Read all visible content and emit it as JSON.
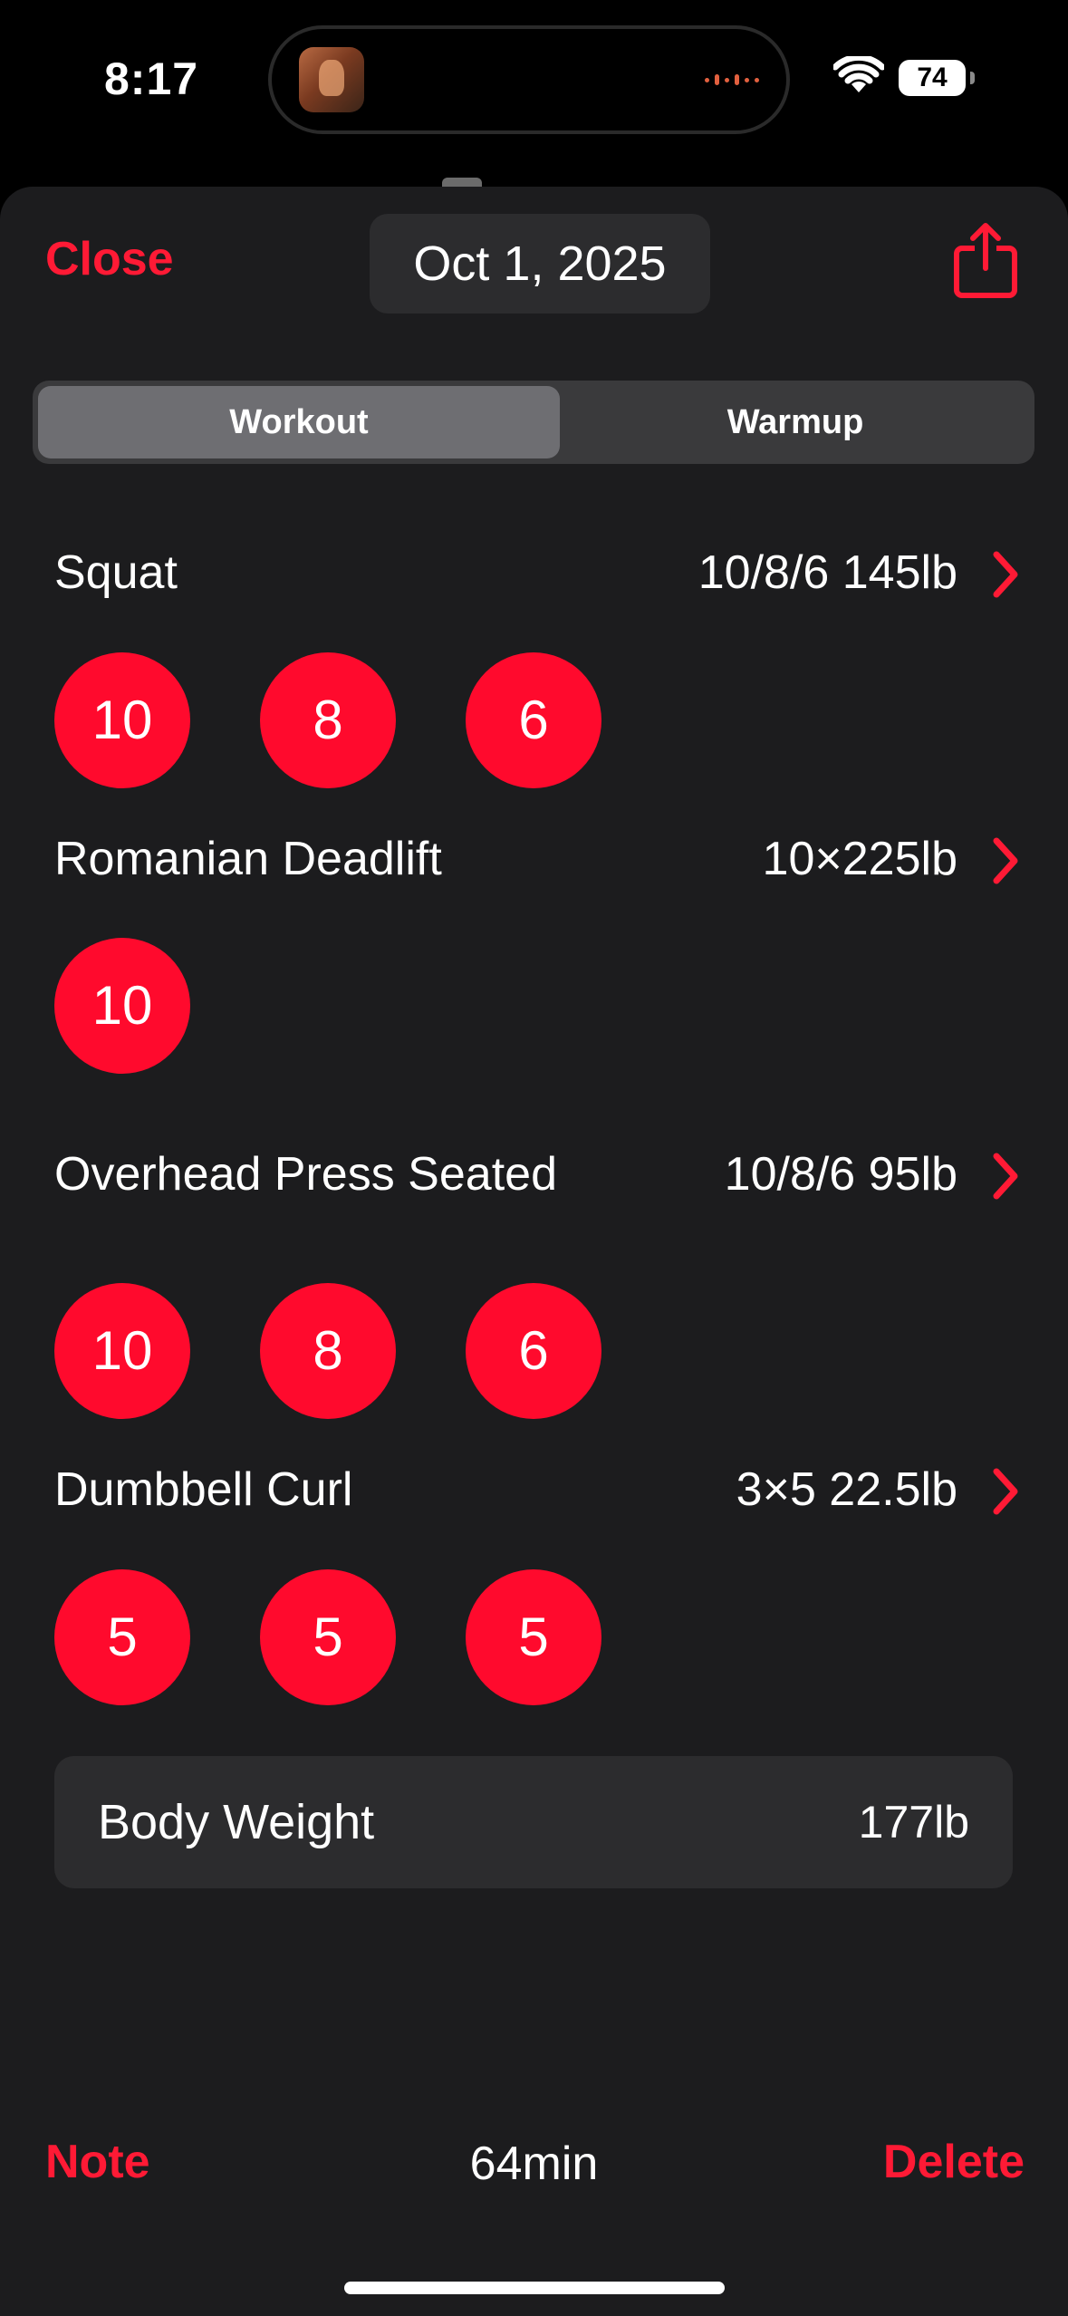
{
  "status": {
    "time": "8:17",
    "battery": "74"
  },
  "header": {
    "close_label": "Close",
    "date": "Oct 1, 2025",
    "share_icon": "share-icon"
  },
  "tabs": [
    {
      "label": "Workout",
      "selected": true
    },
    {
      "label": "Warmup",
      "selected": false
    }
  ],
  "exercises": [
    {
      "name": "Squat",
      "summary": "10/8/6 145lb",
      "sets": [
        "10",
        "8",
        "6"
      ]
    },
    {
      "name": "Romanian Deadlift",
      "summary": "10×225lb",
      "sets": [
        "10"
      ]
    },
    {
      "name": "Overhead Press Seated",
      "summary": "10/8/6 95lb",
      "sets": [
        "10",
        "8",
        "6"
      ]
    },
    {
      "name": "Dumbbell Curl",
      "summary": "3×5 22.5lb",
      "sets": [
        "5",
        "5",
        "5"
      ]
    }
  ],
  "body_weight": {
    "label": "Body Weight",
    "value": "177lb"
  },
  "footer": {
    "note_label": "Note",
    "duration": "64min",
    "delete_label": "Delete"
  },
  "colors": {
    "accent": "#ff0a2d",
    "background": "#1c1c1e",
    "card": "#2c2c2e"
  }
}
